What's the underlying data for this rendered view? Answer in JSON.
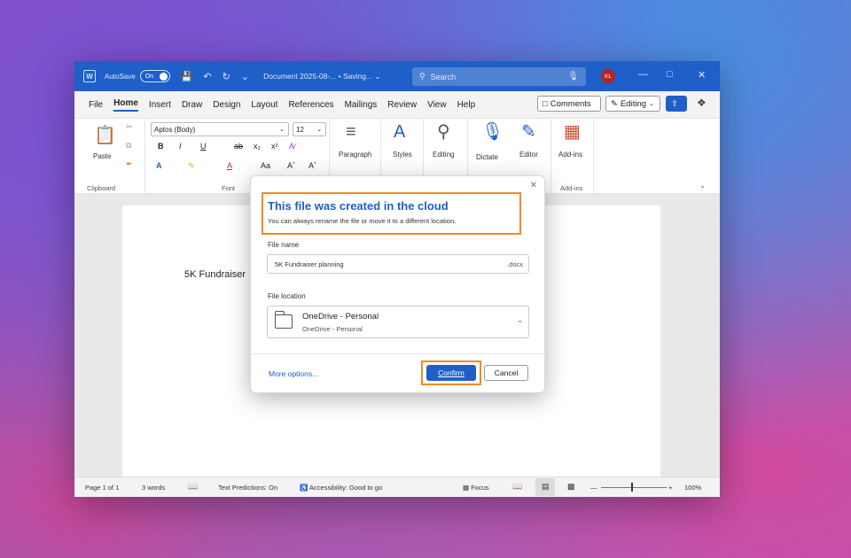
{
  "titlebar": {
    "autosave_label": "AutoSave",
    "autosave_state": "On",
    "doc_title": "Document 2025-08-...  •  Saving... ⌄",
    "search_placeholder": "Search",
    "avatar_initials": "KL"
  },
  "menu": {
    "tabs": [
      "File",
      "Home",
      "Insert",
      "Draw",
      "Design",
      "Layout",
      "References",
      "Mailings",
      "Review",
      "View",
      "Help"
    ],
    "active_tab": "Home",
    "comments_label": "Comments",
    "editing_label": "Editing"
  },
  "ribbon": {
    "paste_label": "Paste",
    "clipboard_label": "Clipboard",
    "font_name": "Aptos (Body)",
    "font_size": "12",
    "font_label": "Font",
    "paragraph_label": "Paragraph",
    "styles_label": "Styles",
    "editing_label": "Editing",
    "dictate_label": "Dictate",
    "editor_label": "Editor",
    "addins_label": "Add-ins",
    "addins_group_label": "Add-ins"
  },
  "document": {
    "body_text": "5K Fundraiser"
  },
  "dialog": {
    "title": "This file was created in the cloud",
    "subtitle": "You can always rename the file or move it to a different location.",
    "file_name_label": "File name",
    "file_name_value": "5K Fundraiser planning",
    "file_ext": ".docx",
    "file_location_label": "File location",
    "location_main": "OneDrive - Personal",
    "location_sub": "OneDrive - Personal",
    "more_options": "More options...",
    "confirm": "Confirm",
    "cancel": "Cancel"
  },
  "statusbar": {
    "page": "Page 1 of 1",
    "words": "3 words",
    "predictions": "Text Predictions: On",
    "accessibility": "Accessibility: Good to go",
    "focus": "Focus",
    "zoom": "100%"
  },
  "colors": {
    "accent": "#1f5fc8",
    "highlight": "#f08a24"
  }
}
